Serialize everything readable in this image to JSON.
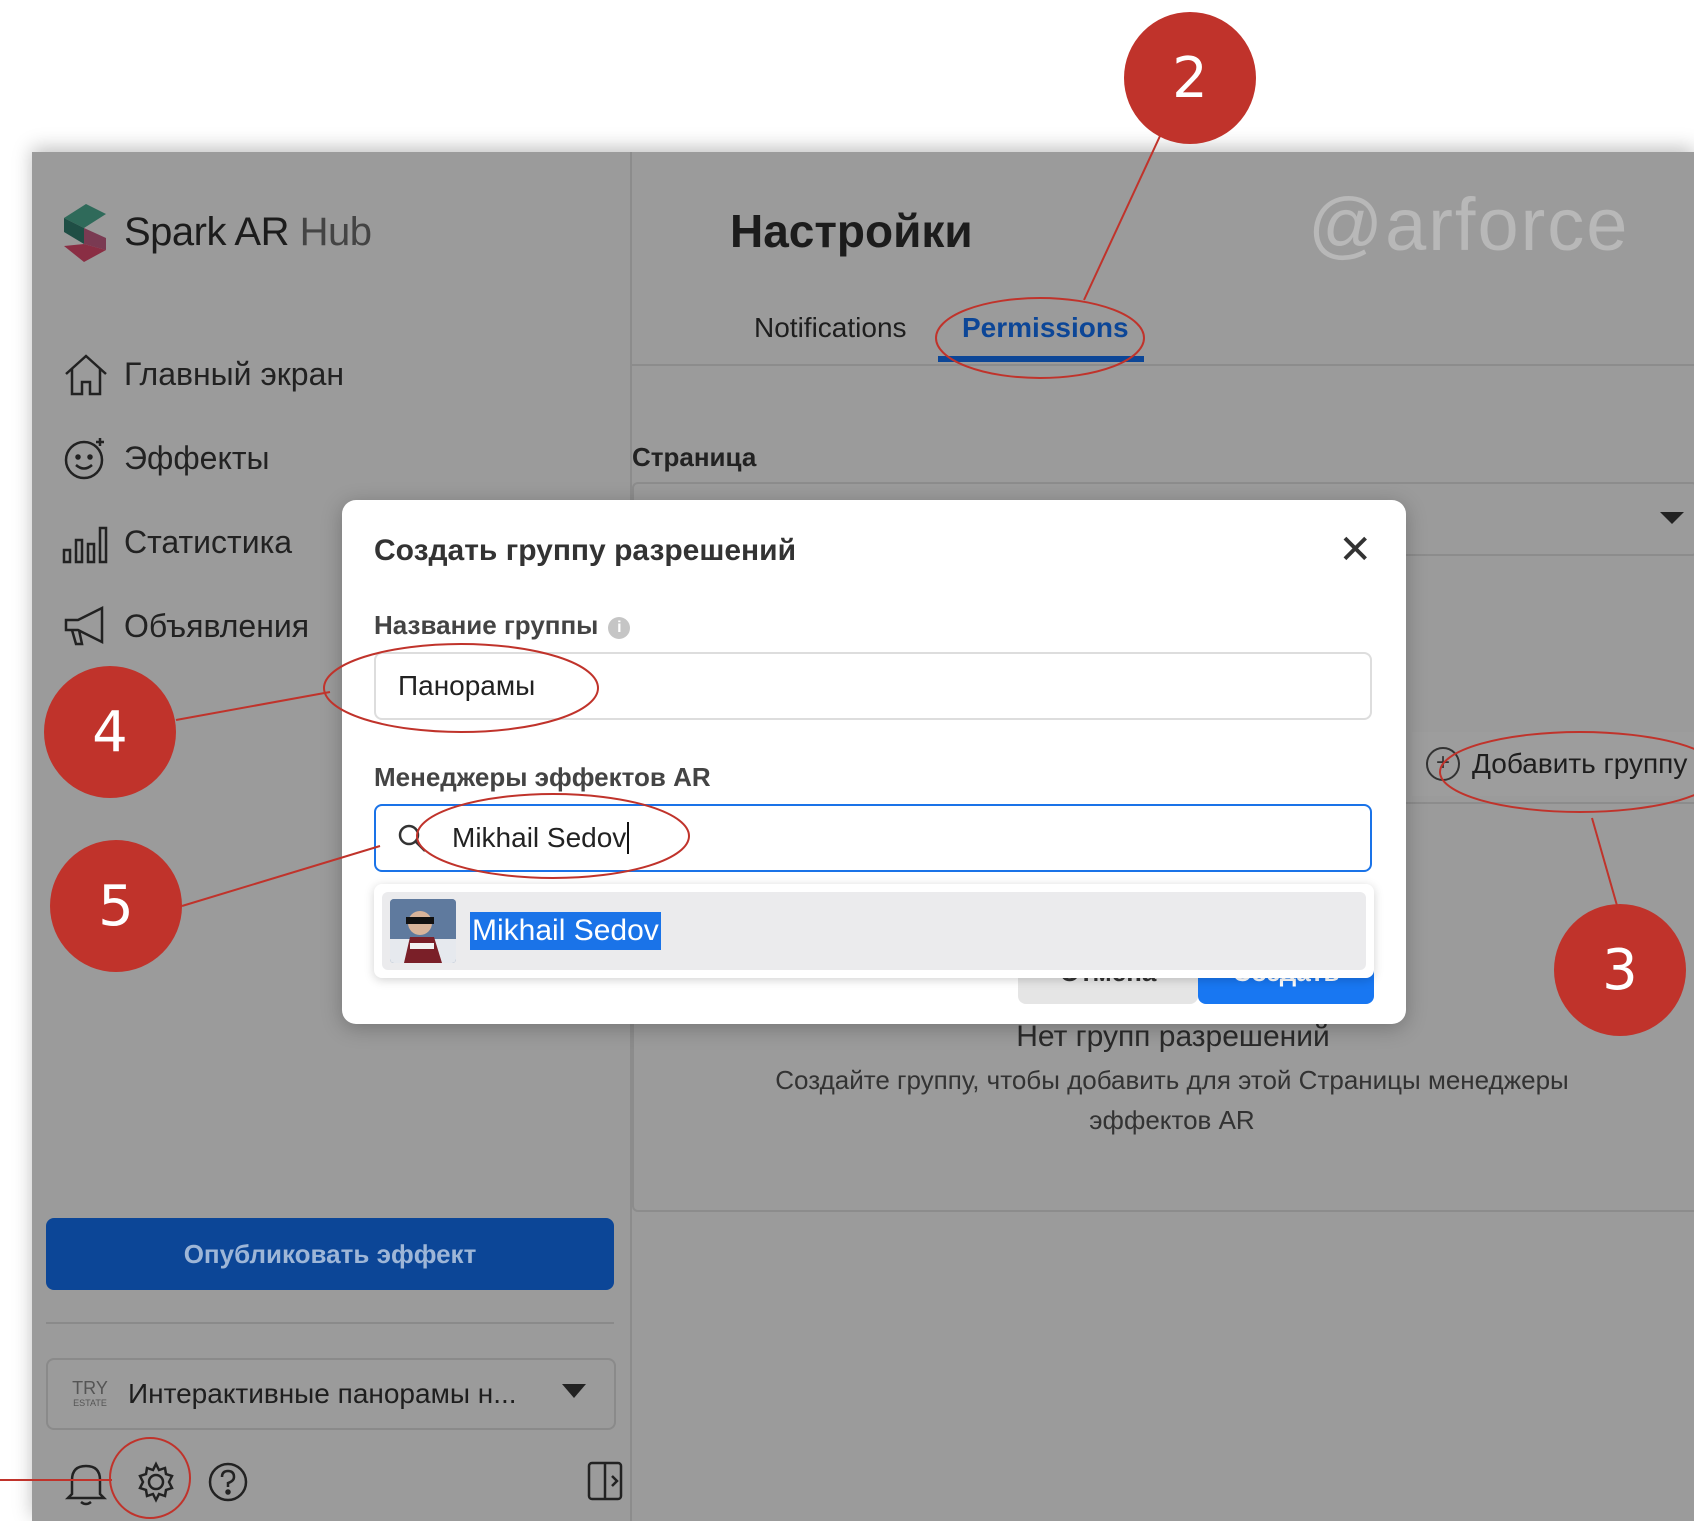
{
  "app": {
    "logo": {
      "name": "Spark AR",
      "suffix": "Hub"
    },
    "nav": [
      {
        "label": "Главный экран",
        "icon": "home-icon"
      },
      {
        "label": "Эффекты",
        "icon": "effects-icon"
      },
      {
        "label": "Статистика",
        "icon": "stats-icon"
      },
      {
        "label": "Объявления",
        "icon": "megaphone-icon"
      }
    ],
    "publish_label": "Опубликовать эффект",
    "page_select": {
      "logo_top": "TRY",
      "logo_bottom": "ESTATE",
      "label": "Интерактивные панорамы н..."
    }
  },
  "content": {
    "title": "Настройки",
    "watermark": "@arforce",
    "tabs": [
      {
        "label": "Notifications",
        "active": false
      },
      {
        "label": "Permissions",
        "active": true
      }
    ],
    "section_label": "Страница",
    "add_group_label": "Добавить группу",
    "empty_title": "Нет групп разрешений",
    "empty_desc": "Создайте группу, чтобы добавить для этой Страницы менеджеры эффектов AR"
  },
  "modal": {
    "title": "Создать группу разрешений",
    "close": "✕",
    "group_name_label": "Название группы",
    "info": "i",
    "group_name_value": "Панорамы",
    "managers_label": "Менеджеры эффектов AR",
    "search_value": "Mikhail Sedov",
    "suggestion_name": "Mikhail Sedov",
    "cancel_label": "Отмена",
    "create_label": "Создать"
  },
  "annotations": [
    "2",
    "3",
    "4",
    "5"
  ],
  "colors": {
    "annotation": "#c0332b",
    "primary": "#1877f2",
    "overlay": "#9b9b9b"
  }
}
